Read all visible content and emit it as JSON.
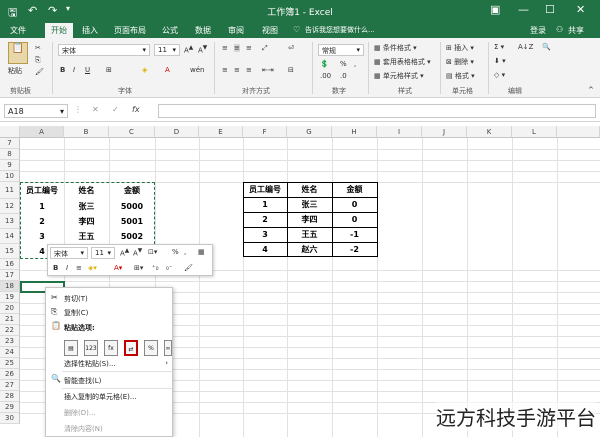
{
  "window": {
    "title": "工作簿1 - Excel"
  },
  "menu": {
    "tabs": [
      "文件",
      "开始",
      "插入",
      "页面布局",
      "公式",
      "数据",
      "审阅",
      "视图"
    ],
    "active": "开始",
    "tellme": "告诉我您想要做什么...",
    "login": "登录",
    "share": "共享"
  },
  "ribbon": {
    "paste": "粘贴",
    "clipboard": "剪贴板",
    "font_name": "宋体",
    "font_size": "11",
    "font_group": "字体",
    "align_group": "对齐方式",
    "number_format": "常规",
    "number_group": "数字",
    "cond_format": "条件格式",
    "table_format": "套用表格格式",
    "cell_style": "单元格样式",
    "style_group": "样式",
    "insert": "插入",
    "delete": "删除",
    "format": "格式",
    "cells_group": "单元格",
    "edit_group": "编辑"
  },
  "formula": {
    "name_box": "A18",
    "fx": "fx"
  },
  "columns": [
    "A",
    "B",
    "C",
    "D",
    "E",
    "F",
    "G",
    "H",
    "I",
    "J",
    "K",
    "L"
  ],
  "rows": [
    "7",
    "8",
    "9",
    "10",
    "11",
    "12",
    "13",
    "14",
    "15",
    "16",
    "17",
    "18",
    "19",
    "20",
    "21",
    "22",
    "23",
    "24",
    "25",
    "26",
    "27",
    "28",
    "29",
    "30"
  ],
  "left_table": {
    "headers": [
      "员工编号",
      "姓名",
      "金额"
    ],
    "rows": [
      [
        "1",
        "张三",
        "5000"
      ],
      [
        "2",
        "李四",
        "5001"
      ],
      [
        "3",
        "王五",
        "5002"
      ],
      [
        "4",
        "",
        ""
      ]
    ]
  },
  "right_table": {
    "headers": [
      "员工编号",
      "姓名",
      "金额"
    ],
    "rows": [
      [
        "1",
        "张三",
        "0"
      ],
      [
        "2",
        "李四",
        "0"
      ],
      [
        "3",
        "王五",
        "-1"
      ],
      [
        "4",
        "赵六",
        "-2"
      ]
    ]
  },
  "mini_toolbar": {
    "font": "宋体",
    "size": "11",
    "percent": "%"
  },
  "context_menu": {
    "cut": "剪切(T)",
    "copy": "复制(C)",
    "paste_options": "粘贴选项:",
    "paste_special": "选择性粘贴(S)...",
    "smart_lookup": "智能查找(L)",
    "insert_copied": "插入复制的单元格(E)...",
    "delete": "删除(D)...",
    "clear": "清除内容(N)"
  },
  "watermark": "远方科技手游平台"
}
